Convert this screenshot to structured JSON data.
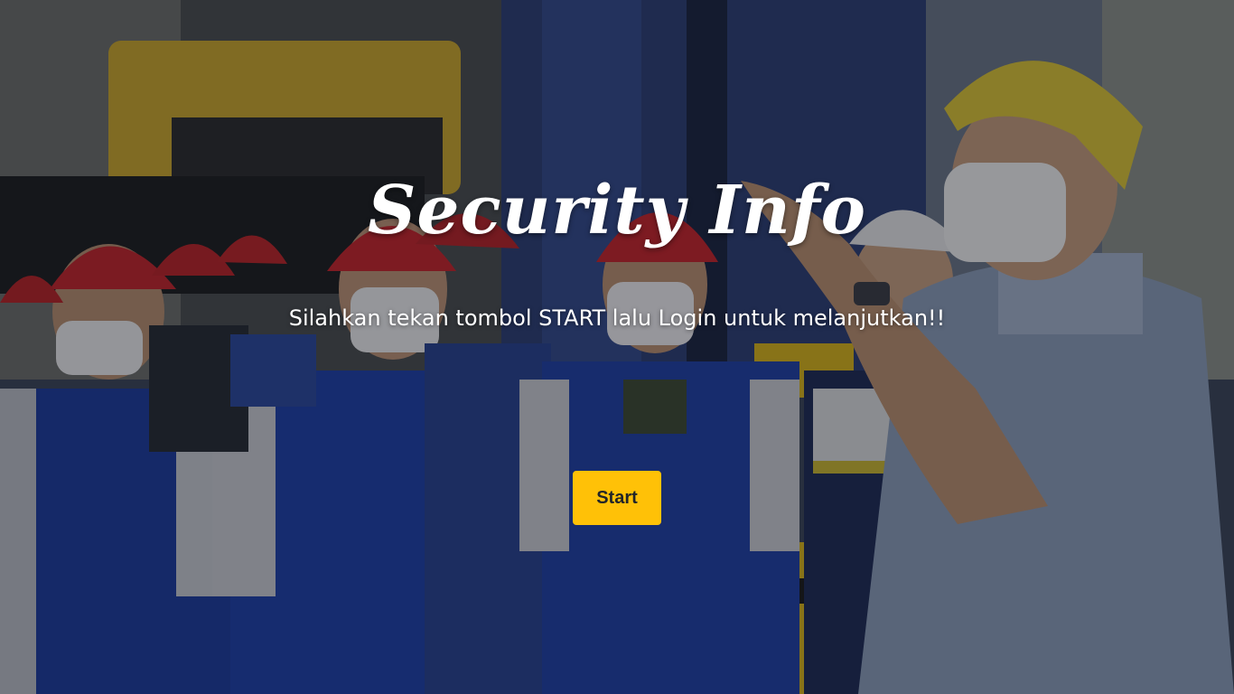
{
  "hero": {
    "title": "Security Info",
    "subtitle": "Silahkan tekan tombol START lalu Login untuk melanjutkan!!",
    "start_label": "Start"
  },
  "colors": {
    "accent": "#ffc107",
    "text": "#ffffff",
    "button_text": "#212529"
  }
}
